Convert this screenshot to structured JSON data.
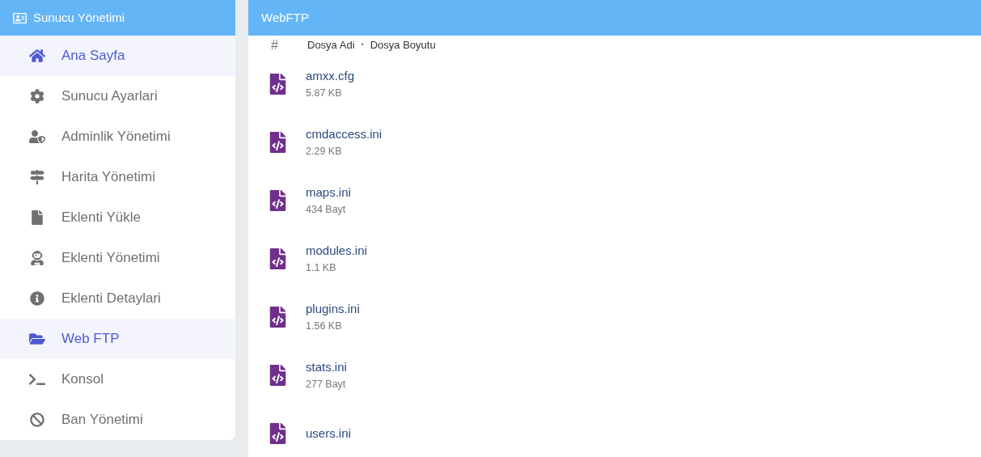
{
  "sidebar": {
    "title": "Sunucu Yönetimi",
    "items": [
      {
        "label": "Ana Sayfa",
        "selected": true
      },
      {
        "label": "Sunucu Ayarlari",
        "selected": false
      },
      {
        "label": "Adminlik Yönetimi",
        "selected": false
      },
      {
        "label": "Harita Yönetimi",
        "selected": false
      },
      {
        "label": "Eklenti Yükle",
        "selected": false
      },
      {
        "label": "Eklenti Yönetimi",
        "selected": false
      },
      {
        "label": "Eklenti Detaylari",
        "selected": false
      },
      {
        "label": "Web FTP",
        "selected": true
      },
      {
        "label": "Konsol",
        "selected": false
      },
      {
        "label": "Ban Yönetimi",
        "selected": false
      }
    ]
  },
  "panel": {
    "title": "WebFTP",
    "header": {
      "index": "#",
      "name": "Dosya Adi",
      "separator": "•",
      "size": "Dosya Boyutu"
    },
    "files": [
      {
        "name": "amxx.cfg",
        "size": "5.87 KB"
      },
      {
        "name": "cmdaccess.ini",
        "size": "2.29 KB"
      },
      {
        "name": "maps.ini",
        "size": "434 Bayt"
      },
      {
        "name": "modules.ini",
        "size": "1.1 KB"
      },
      {
        "name": "plugins.ini",
        "size": "1.56 KB"
      },
      {
        "name": "stats.ini",
        "size": "277 Bayt"
      },
      {
        "name": "users.ini"
      }
    ]
  }
}
